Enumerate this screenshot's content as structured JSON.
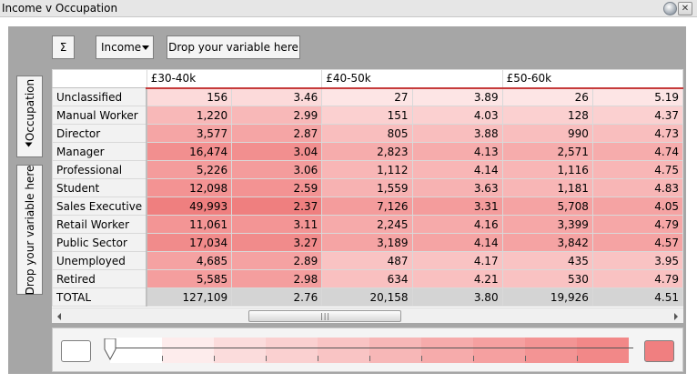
{
  "window": {
    "title": "Income v Occupation"
  },
  "toolbar": {
    "sigma_label": "Σ",
    "measure_label": "Income",
    "drop_column_label": "Drop your variable here"
  },
  "row_axis": {
    "variable_label": "Occupation",
    "drop_row_label": "Drop your variable here"
  },
  "grid": {
    "column_groups": [
      "£30-40k",
      "£40-50k",
      "£50-60k"
    ],
    "rows": [
      {
        "label": "Unclassified",
        "values": [
          "156",
          "3.46",
          "27",
          "3.89",
          "26",
          "5.19"
        ]
      },
      {
        "label": "Manual Worker",
        "values": [
          "1,220",
          "2.99",
          "151",
          "4.03",
          "128",
          "4.37"
        ]
      },
      {
        "label": "Director",
        "values": [
          "3,577",
          "2.87",
          "805",
          "3.88",
          "990",
          "4.73"
        ]
      },
      {
        "label": "Manager",
        "values": [
          "16,474",
          "3.04",
          "2,823",
          "4.13",
          "2,571",
          "4.74"
        ]
      },
      {
        "label": "Professional",
        "values": [
          "5,226",
          "3.06",
          "1,112",
          "4.14",
          "1,116",
          "4.75"
        ]
      },
      {
        "label": "Student",
        "values": [
          "12,098",
          "2.59",
          "1,559",
          "3.63",
          "1,181",
          "4.83"
        ]
      },
      {
        "label": "Sales Executive",
        "values": [
          "49,993",
          "2.37",
          "7,126",
          "3.31",
          "5,708",
          "4.05"
        ]
      },
      {
        "label": "Retail Worker",
        "values": [
          "11,061",
          "3.11",
          "2,245",
          "4.16",
          "3,399",
          "4.79"
        ]
      },
      {
        "label": "Public Sector",
        "values": [
          "17,034",
          "3.27",
          "3,189",
          "4.14",
          "3,842",
          "4.57"
        ]
      },
      {
        "label": "Unemployed",
        "values": [
          "4,685",
          "2.89",
          "487",
          "4.17",
          "435",
          "3.95"
        ]
      },
      {
        "label": "Retired",
        "values": [
          "5,585",
          "2.98",
          "634",
          "4.21",
          "530",
          "4.79"
        ]
      }
    ],
    "total": {
      "label": "TOTAL",
      "values": [
        "127,109",
        "2.76",
        "20,158",
        "3.80",
        "19,926",
        "4.51"
      ]
    },
    "cell_shades": [
      [
        "#fcdada",
        "#fcdada",
        "#fde5e5",
        "#fde5e5",
        "#fde5e5",
        "#fde5e5"
      ],
      [
        "#f8b8b8",
        "#f8b8b8",
        "#fbd0d0",
        "#fbd0d0",
        "#fbd0d0",
        "#fbd0d0"
      ],
      [
        "#f5a5a5",
        "#f5a5a5",
        "#f9bebe",
        "#f9bebe",
        "#f9bebe",
        "#f9bebe"
      ],
      [
        "#f28f8f",
        "#f28f8f",
        "#f6acac",
        "#f6acac",
        "#f6acac",
        "#f6acac"
      ],
      [
        "#f49c9c",
        "#f49c9c",
        "#f8b6b6",
        "#f8b6b6",
        "#f8b6b6",
        "#f8b6b6"
      ],
      [
        "#f39393",
        "#f39393",
        "#f7b2b2",
        "#f7b2b2",
        "#f8b6b6",
        "#f8b6b6"
      ],
      [
        "#ef7f7f",
        "#ef7f7f",
        "#f49c9c",
        "#f49c9c",
        "#f5a3a3",
        "#f5a3a3"
      ],
      [
        "#f39595",
        "#f39595",
        "#f6aaaa",
        "#f6aaaa",
        "#f6a7a7",
        "#f6a7a7"
      ],
      [
        "#f18b8b",
        "#f18b8b",
        "#f5a4a4",
        "#f5a4a4",
        "#f5a3a3",
        "#f5a3a3"
      ],
      [
        "#f5a2a2",
        "#f5a2a2",
        "#f9c3c3",
        "#f9c3c3",
        "#f9c3c3",
        "#f9c3c3"
      ],
      [
        "#f49e9e",
        "#f49e9e",
        "#f9c0c0",
        "#f9c0c0",
        "#f9c2c2",
        "#f9c2c2"
      ]
    ]
  },
  "legend": {
    "low_color": "#ffffff",
    "high_color": "#f07f80",
    "ramp_colors": [
      "#ffffff",
      "#fdecec",
      "#fbdcdc",
      "#fad0d0",
      "#f9c4c4",
      "#f7b7b7",
      "#f6abab",
      "#f5a0a0",
      "#f39494",
      "#f28888"
    ]
  }
}
